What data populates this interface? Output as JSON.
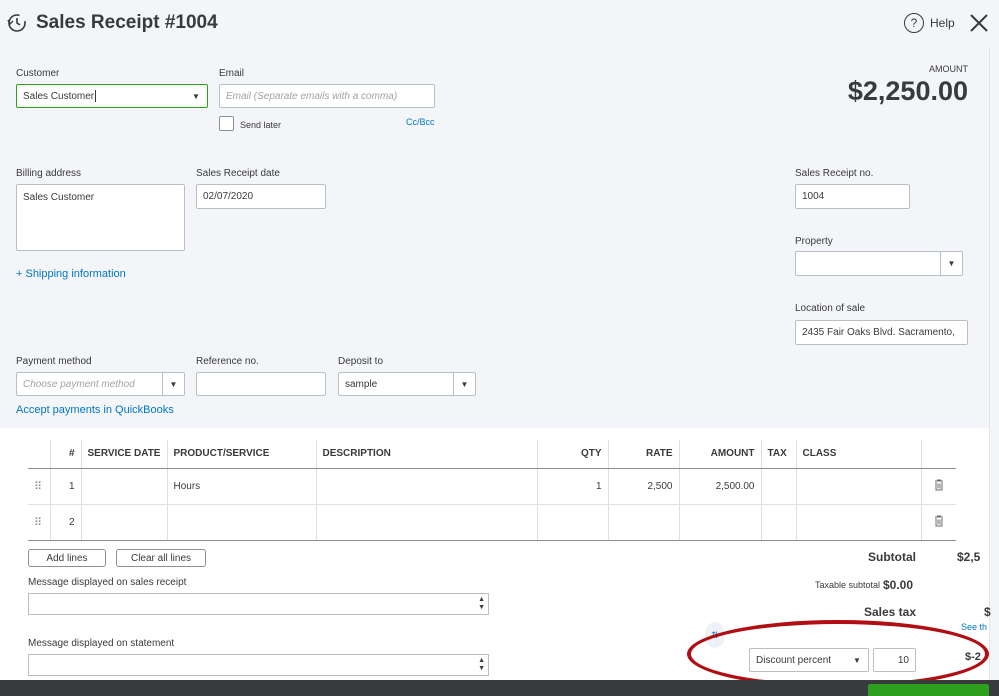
{
  "header": {
    "title": "Sales Receipt #1004",
    "help_label": "Help"
  },
  "customer": {
    "label": "Customer",
    "value": "Sales Customer"
  },
  "email": {
    "label": "Email",
    "placeholder": "Email (Separate emails with a comma)",
    "send_later_label": "Send later",
    "cc_bcc_label": "Cc/Bcc"
  },
  "amount": {
    "label": "AMOUNT",
    "value": "$2,250.00"
  },
  "billing": {
    "label": "Billing address",
    "value": "Sales Customer"
  },
  "receipt_date": {
    "label": "Sales Receipt date",
    "value": "02/07/2020"
  },
  "receipt_no": {
    "label": "Sales Receipt no.",
    "value": "1004"
  },
  "property": {
    "label": "Property",
    "value": ""
  },
  "location": {
    "label": "Location of sale",
    "value": "2435 Fair Oaks Blvd. Sacramento,"
  },
  "shipping_link": "+ Shipping information",
  "payment_method": {
    "label": "Payment method",
    "placeholder": "Choose payment method"
  },
  "reference": {
    "label": "Reference no.",
    "value": ""
  },
  "deposit": {
    "label": "Deposit to",
    "value": "sample"
  },
  "accept_payments_link": "Accept payments in QuickBooks",
  "table": {
    "headers": [
      "#",
      "SERVICE DATE",
      "PRODUCT/SERVICE",
      "DESCRIPTION",
      "QTY",
      "RATE",
      "AMOUNT",
      "TAX",
      "CLASS"
    ],
    "rows": [
      {
        "num": "1",
        "service_date": "",
        "product": "Hours",
        "description": "",
        "qty": "1",
        "rate": "2,500",
        "amount": "2,500.00",
        "tax": "",
        "class": ""
      },
      {
        "num": "2",
        "service_date": "",
        "product": "",
        "description": "",
        "qty": "",
        "rate": "",
        "amount": "",
        "tax": "",
        "class": ""
      }
    ]
  },
  "buttons": {
    "add_lines": "Add lines",
    "clear_all_lines": "Clear all lines"
  },
  "messages": {
    "sales_receipt_label": "Message displayed on sales receipt",
    "statement_label": "Message displayed on statement"
  },
  "totals": {
    "subtotal_label": "Subtotal",
    "subtotal_value": "$2,5",
    "taxable_subtotal_label": "Taxable subtotal",
    "taxable_subtotal_value": "$0.00",
    "sales_tax_label": "Sales tax",
    "sales_tax_value": "$",
    "see_link": "See th",
    "discount_type": "Discount percent",
    "discount_value": "10",
    "discount_amount": "$-2"
  },
  "colors": {
    "accent": "#0077c5",
    "highlight": "#b00e12",
    "focus_border": "#2ca01c"
  }
}
